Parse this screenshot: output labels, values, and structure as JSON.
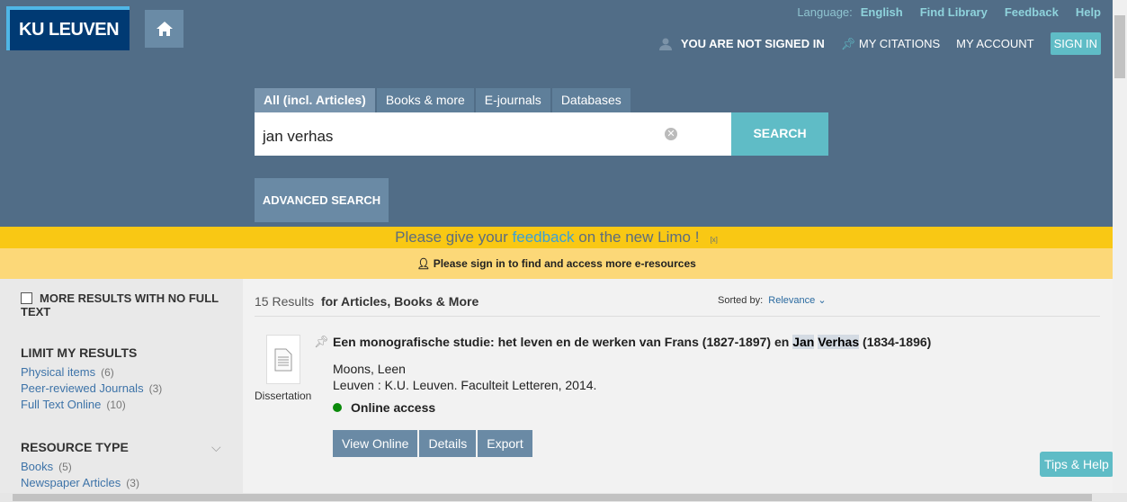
{
  "header": {
    "logo": "KU LEUVEN",
    "language_label": "Language:",
    "language": "English",
    "find_library": "Find Library",
    "feedback": "Feedback",
    "help": "Help",
    "not_signed_in": "YOU ARE NOT SIGNED IN",
    "my_citations": "MY CITATIONS",
    "my_account": "MY ACCOUNT",
    "sign_in": "SIGN IN"
  },
  "search": {
    "tabs": [
      "All (incl. Articles)",
      "Books & more",
      "E-journals",
      "Databases"
    ],
    "query": "jan verhas",
    "button": "SEARCH",
    "advanced": "ADVANCED SEARCH"
  },
  "banner": {
    "pre": "Please give your ",
    "link": "feedback",
    "post": " on the new Limo !",
    "close": "[x]",
    "signin_msg": "Please sign in to find and access more e-resources"
  },
  "sidebar": {
    "no_full_text": "MORE RESULTS WITH NO FULL TEXT",
    "limit_title": "LIMIT MY RESULTS",
    "limit": [
      {
        "label": "Physical items",
        "count": "(6)"
      },
      {
        "label": "Peer-reviewed Journals",
        "count": "(3)"
      },
      {
        "label": "Full Text Online",
        "count": "(10)"
      }
    ],
    "resource_title": "RESOURCE TYPE",
    "resource": [
      {
        "label": "Books",
        "count": "(5)"
      },
      {
        "label": "Newspaper Articles",
        "count": "(3)"
      }
    ]
  },
  "results": {
    "count": "15 Results",
    "for": "for Articles, Books & More",
    "sorted_label": "Sorted by:",
    "sorted_value": "Relevance",
    "items": [
      {
        "type": "Dissertation",
        "title_pre": "Een monografische studie: het leven en de werken van Frans (1827-1897) en ",
        "hl1": "Jan",
        "hl2": "Verhas",
        "title_post": " (1834-1896)",
        "author": "Moons, Leen",
        "publisher": "Leuven : K.U. Leuven. Faculteit Letteren, 2014.",
        "access": "Online access",
        "actions": [
          "View Online",
          "Details",
          "Export"
        ]
      }
    ]
  },
  "tips": "Tips & Help",
  "colors": {
    "header": "#516d87",
    "accent": "#5fbcc6",
    "banner": "#f9c814",
    "online": "#0a8a0a"
  }
}
